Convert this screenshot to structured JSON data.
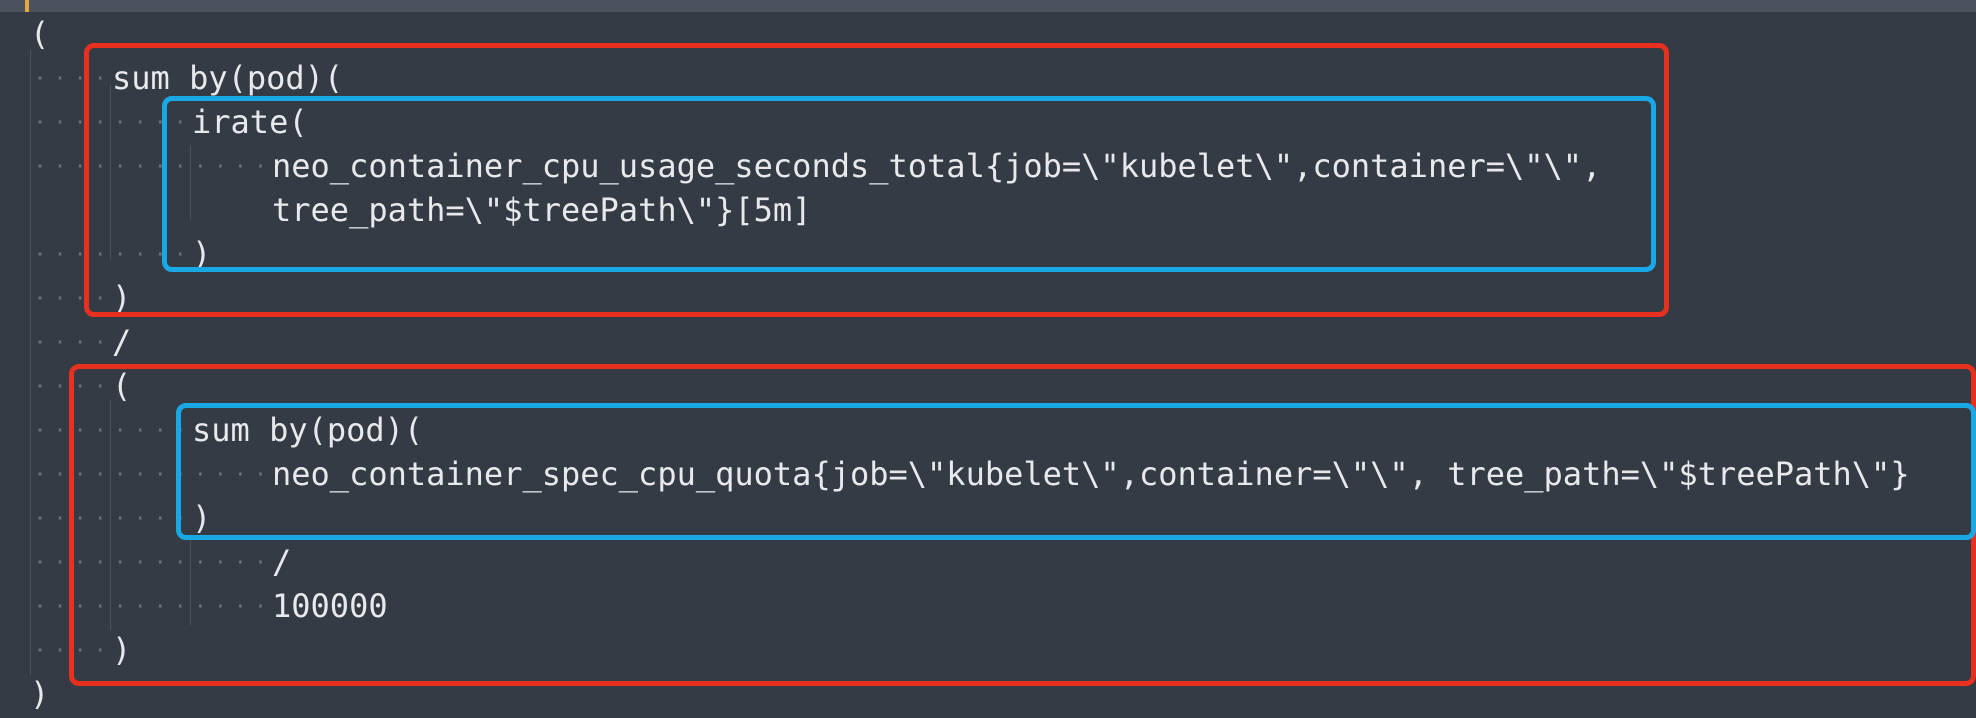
{
  "editor": {
    "lines": [
      {
        "dots": "",
        "text": "("
      },
      {
        "dots": "····",
        "text": "sum by(pod)("
      },
      {
        "dots": "········",
        "text": "irate("
      },
      {
        "dots": "············",
        "text": "neo_container_cpu_usage_seconds_total{job=\\\"kubelet\\\",container=\\\"\\\","
      },
      {
        "dots": "",
        "text": "tree_path=\\\"$treePath\\\"}[5m]"
      },
      {
        "dots": "········",
        "text": ")"
      },
      {
        "dots": "····",
        "text": ")"
      },
      {
        "dots": "····",
        "text": "/"
      },
      {
        "dots": "····",
        "text": "("
      },
      {
        "dots": "········",
        "text": "sum by(pod)("
      },
      {
        "dots": "············",
        "text": "neo_container_spec_cpu_quota{job=\\\"kubelet\\\",container=\\\"\\\", tree_path=\\\"$treePath\\\"}"
      },
      {
        "dots": "········",
        "text": ")"
      },
      {
        "dots": "············",
        "text": "/"
      },
      {
        "dots": "············",
        "text": "100000"
      },
      {
        "dots": "····",
        "text": ")"
      },
      {
        "dots": "",
        "text": ")"
      }
    ]
  },
  "highlight_colors": {
    "outer": "#e8301e",
    "inner": "#19a8e6"
  }
}
